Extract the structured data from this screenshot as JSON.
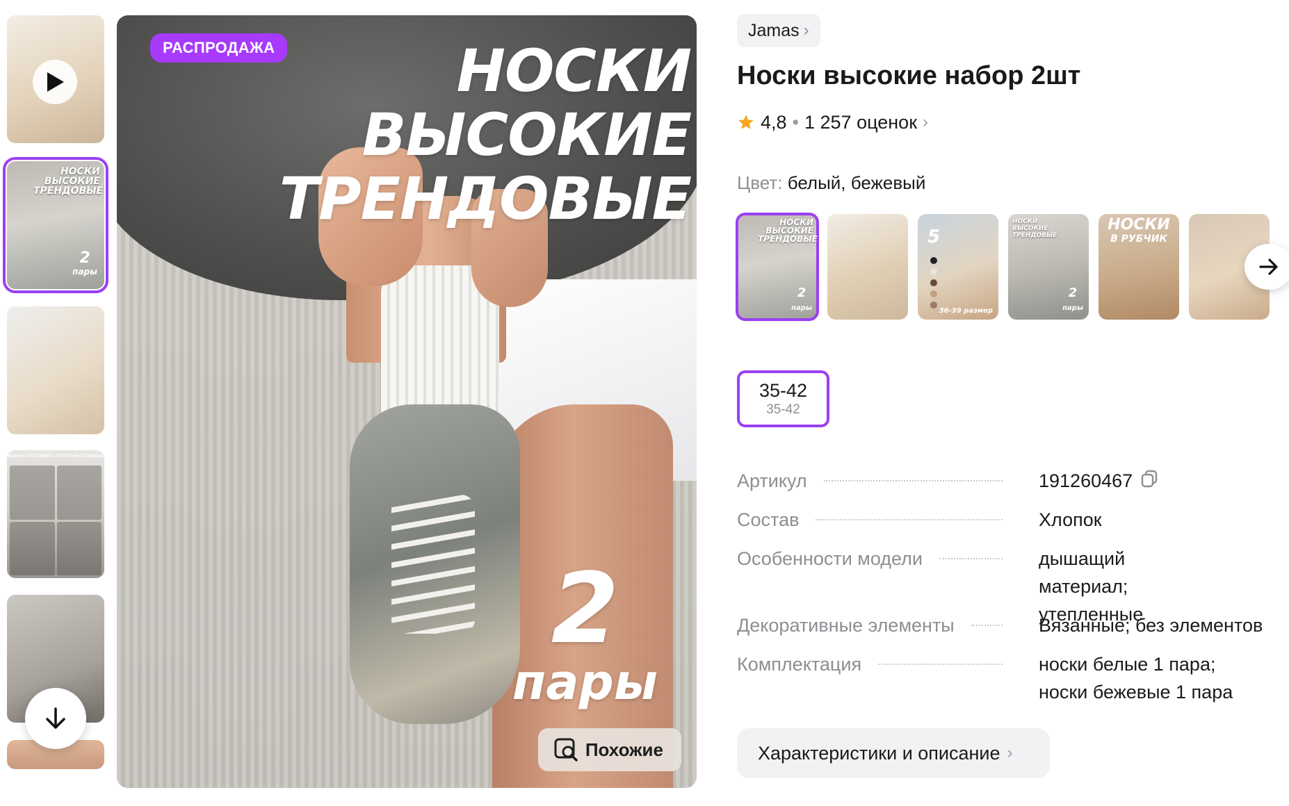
{
  "gallery": {
    "thumbs": [
      {
        "id": "video"
      },
      {
        "id": "cover",
        "text": "НОСКИ ВЫСОКИЕ ТРЕНДОВЫЕ",
        "count": "2",
        "count_word": "пары"
      },
      {
        "id": "socks"
      },
      {
        "id": "outfits",
        "text": "МОЖНО СОСТАВЛЯТЬ ЭСТЕТИЧНЫЕ ОБРАЗЫ"
      },
      {
        "id": "model"
      },
      {
        "id": "partial"
      }
    ]
  },
  "main_image": {
    "badge": "РАСПРОДАЖА",
    "headline": [
      "НОСКИ",
      "ВЫСОКИЕ",
      "ТРЕНДОВЫЕ"
    ],
    "count": "2",
    "count_word": "пары",
    "similar_label": "Похожие"
  },
  "product": {
    "brand": "Jamas",
    "title": "Носки высокие набор 2шт",
    "rating": "4,8",
    "reviews": "1 257 оценок",
    "color_label": "Цвет:",
    "color_value": "белый, бежевый",
    "variants": {
      "v1": {
        "text": "НОСКИ ВЫСОКИЕ ТРЕНДОВЫЕ",
        "count": "2",
        "count_word": "пары"
      },
      "v3": {
        "count": "5",
        "sub": "36-39 размер"
      },
      "v4": {
        "text": "НОСКИ ВЫСОКИЕ ТРЕНДОВЫЕ",
        "count": "2",
        "count_word": "пары"
      },
      "v5": {
        "title": "НОСКИ",
        "sub": "В РУБЧИК"
      }
    },
    "size": {
      "main": "35-42",
      "sub": "35-42"
    },
    "specs": [
      {
        "key": "Артикул",
        "value": "191260467"
      },
      {
        "key": "Состав",
        "value": "Хлопок"
      },
      {
        "key": "Особенности модели",
        "value": "дышащий материал; утепленные"
      },
      {
        "key": "Декоративные элементы",
        "value": "Вязанные; без элементов"
      },
      {
        "key": "Комплектация",
        "value": "носки белые 1 пара; носки бежевые 1 пара"
      }
    ],
    "details_button": "Характеристики и описание"
  },
  "colors": {
    "accent": "#9b3ff3",
    "badge": "#a73afd",
    "star": "#f5a623",
    "muted": "#8e8e93"
  },
  "icons": [
    "play-icon",
    "arrow-down-icon",
    "arrow-right-icon",
    "chevron-right-icon",
    "star-icon",
    "copy-icon",
    "image-search-icon"
  ]
}
